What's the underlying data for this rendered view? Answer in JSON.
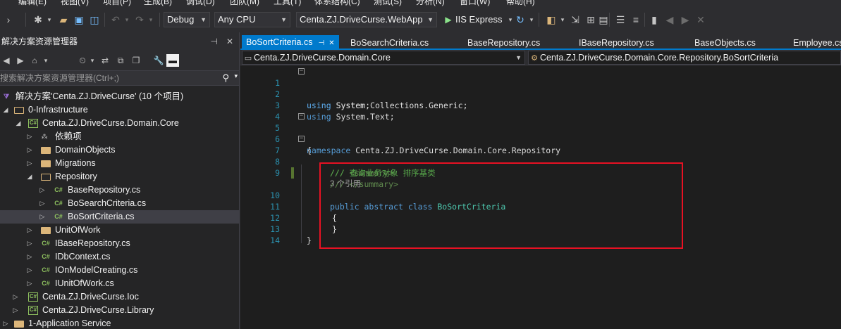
{
  "menu": [
    "编辑(E)",
    "视图(V)",
    "项目(P)",
    "生成(B)",
    "调试(D)",
    "团队(M)",
    "工具(T)",
    "体系结构(C)",
    "测试(S)",
    "分析(N)",
    "窗口(W)",
    "帮助(H)"
  ],
  "toolbar": {
    "config": "Debug",
    "platform": "Any CPU",
    "startup_project": "Centa.ZJ.DriveCurse.WebApp",
    "run_label": "IIS Express"
  },
  "solution_explorer": {
    "title": "解决方案资源管理器",
    "search_placeholder": "搜索解决方案资源管理器(Ctrl+;)",
    "tree": [
      {
        "label": "解决方案'Centa.ZJ.DriveCurse' (10 个项目)",
        "icon": "solution-icon"
      },
      {
        "label": "0-Infrastructure",
        "icon": "folder-icon"
      },
      {
        "label": "Centa.ZJ.DriveCurse.Domain.Core",
        "icon": "csharp-project-icon"
      },
      {
        "label": "依赖项",
        "icon": "dependencies-icon"
      },
      {
        "label": "DomainObjects",
        "icon": "folder-icon"
      },
      {
        "label": "Migrations",
        "icon": "folder-icon"
      },
      {
        "label": "Repository",
        "icon": "folder-icon"
      },
      {
        "label": "BaseRepository.cs",
        "icon": "csharp-file-icon"
      },
      {
        "label": "BoSearchCriteria.cs",
        "icon": "csharp-file-icon"
      },
      {
        "label": "BoSortCriteria.cs",
        "icon": "csharp-file-icon"
      },
      {
        "label": "UnitOfWork",
        "icon": "folder-icon"
      },
      {
        "label": "IBaseRepository.cs",
        "icon": "csharp-file-icon"
      },
      {
        "label": "IDbContext.cs",
        "icon": "csharp-file-icon"
      },
      {
        "label": "IOnModelCreating.cs",
        "icon": "csharp-file-icon"
      },
      {
        "label": "IUnitOfWork.cs",
        "icon": "csharp-file-icon"
      },
      {
        "label": "Centa.ZJ.DriveCurse.Ioc",
        "icon": "csharp-project-icon"
      },
      {
        "label": "Centa.ZJ.DriveCurse.Library",
        "icon": "csharp-project-icon"
      },
      {
        "label": "1-Application Service",
        "icon": "folder-icon"
      }
    ]
  },
  "tabs": [
    {
      "label": "BoSortCriteria.cs",
      "active": true
    },
    {
      "label": "BoSearchCriteria.cs"
    },
    {
      "label": "BaseRepository.cs"
    },
    {
      "label": "IBaseRepository.cs"
    },
    {
      "label": "BaseObjects.cs"
    },
    {
      "label": "Employee.cs"
    }
  ],
  "navbar": {
    "project": "Centa.ZJ.DriveCurse.Domain.Core",
    "type": "Centa.ZJ.DriveCurse.Domain.Core.Repository.BoSortCriteria"
  },
  "code": {
    "line_numbers": [
      "1",
      "2",
      "3",
      "4",
      "5",
      "6",
      "7",
      "8",
      "9",
      "10",
      "11",
      "12",
      "13",
      "14"
    ],
    "using1": "System;",
    "using2": "System.Collections.Generic;",
    "using3": "System.Text;",
    "namespace_name": "Centa.ZJ.DriveCurse.Domain.Core.Repository",
    "open_brace": "{",
    "close_brace": "}",
    "summary_open": "/// <summary>",
    "summary_text": "/// 查询业务对象 排序基类",
    "summary_close": "/// </summary>",
    "codelens": "3 个引用",
    "class_name": "BoSortCriteria",
    "kw_using": "using",
    "kw_namespace": "namespace",
    "kw_public": "public",
    "kw_abstract": "abstract",
    "kw_class": "class"
  },
  "colors": {
    "accent": "#007acc",
    "highlight_box": "#e81123",
    "keyword": "#569cd6",
    "comment": "#57a64a",
    "type": "#4ec9b0",
    "line_number": "#2b91af"
  }
}
